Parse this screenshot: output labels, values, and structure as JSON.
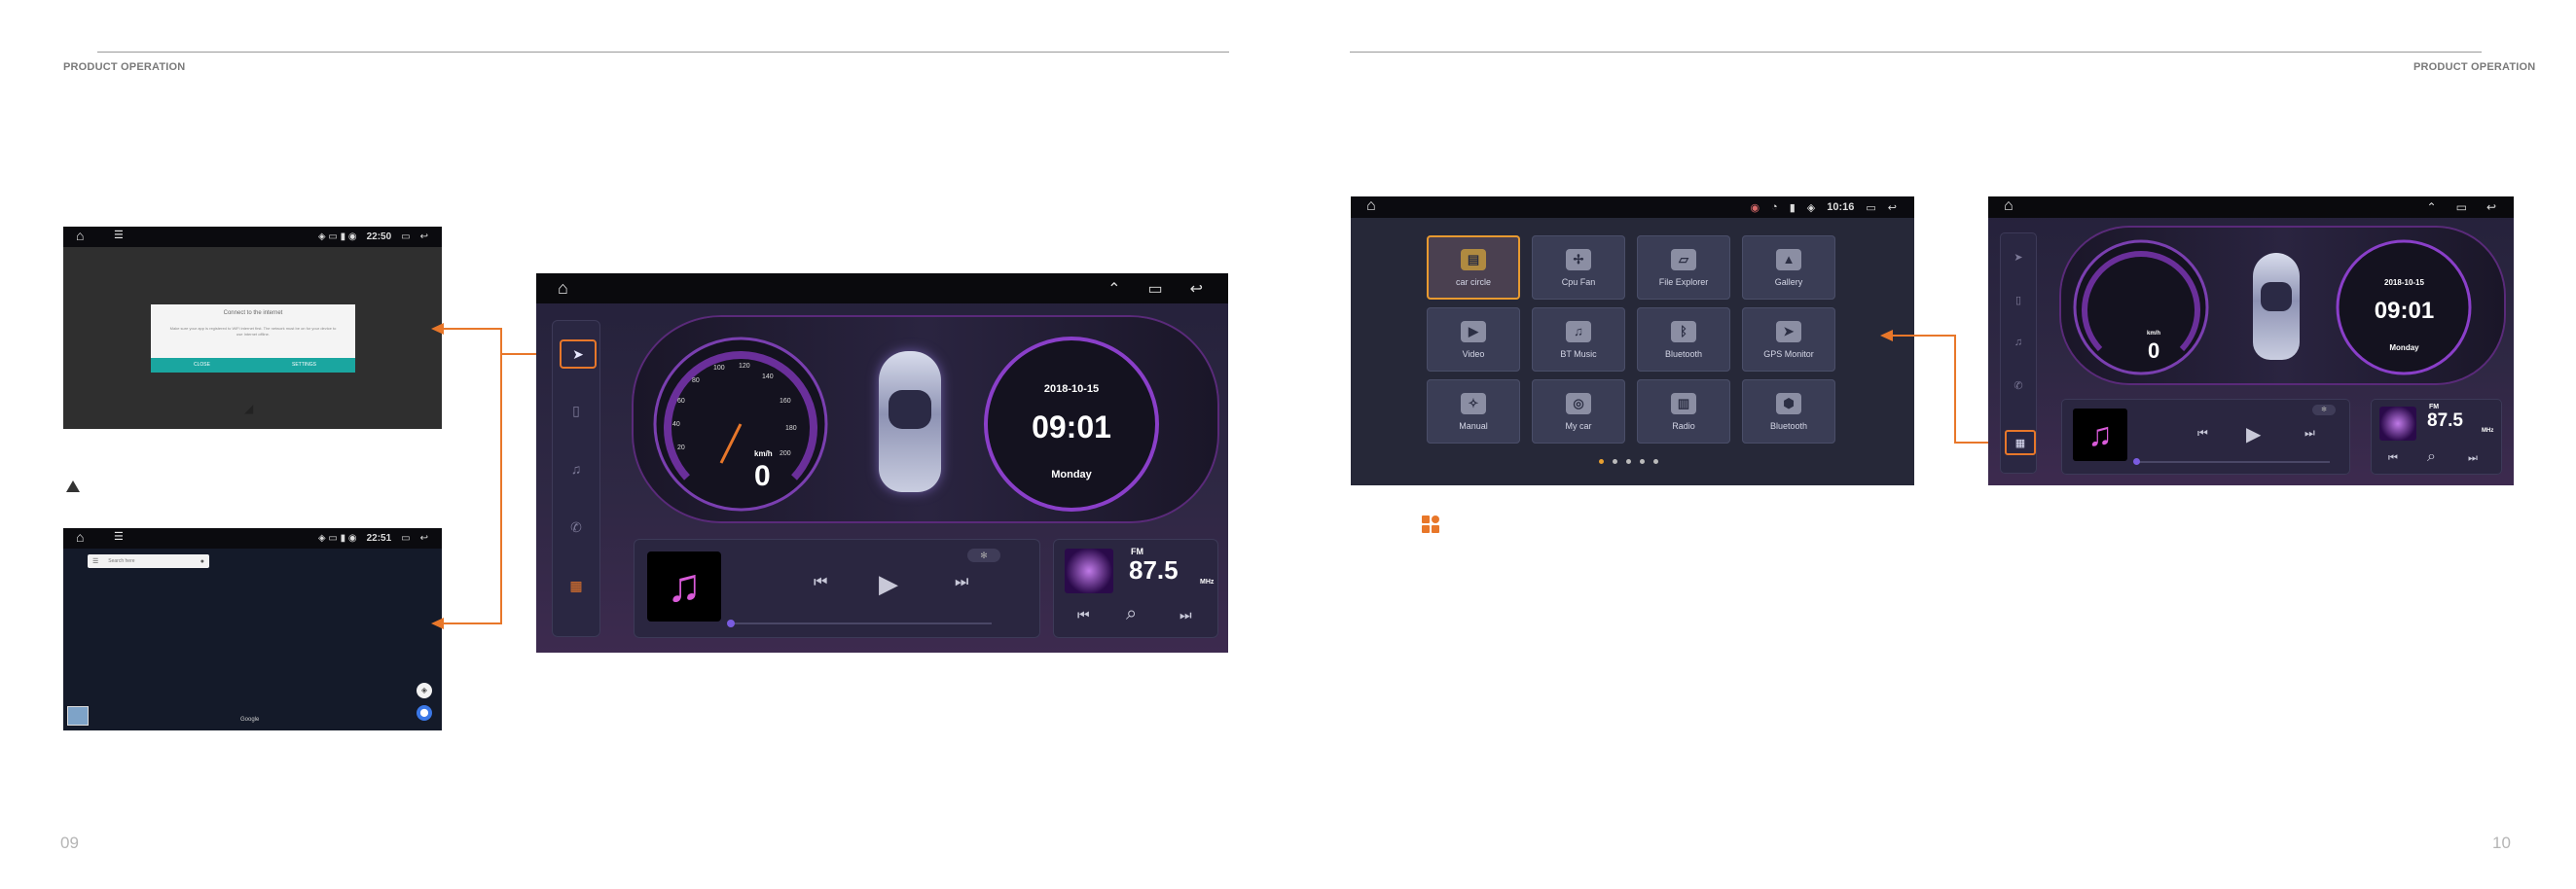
{
  "left_page": {
    "header": "PRODUCT OPERATION",
    "page_number": "09",
    "dialog_shot": {
      "time": "22:50",
      "dialog_title": "Connect to the internet",
      "dialog_body": "Make sure your app is registered to WiFi internet first. The network must be on for your device to use Internet offline.",
      "close_label": "CLOSE",
      "settings_label": "SETTINGS"
    },
    "warning_icon": "warning-triangle-icon",
    "map_shot": {
      "time": "22:51",
      "search_placeholder": "Search here",
      "google_label": "Google"
    },
    "dashboard": {
      "speed_unit": "km/h",
      "speed": "0",
      "gauge_ticks": [
        "20",
        "40",
        "60",
        "80",
        "100",
        "120",
        "140",
        "160",
        "180",
        "200"
      ],
      "date": "2018-10-15",
      "time": "09:01",
      "day": "Monday",
      "fm_label": "FM",
      "fm_freq": "87.5",
      "fm_unit": "MHz"
    }
  },
  "right_page": {
    "header": "PRODUCT OPERATION",
    "page_number": "10",
    "apps_shot": {
      "time": "10:16",
      "apps": [
        {
          "label": "car circle",
          "icon": "car-circle-icon",
          "selected": true
        },
        {
          "label": "Cpu Fan",
          "icon": "fan-icon"
        },
        {
          "label": "File Explorer",
          "icon": "folder-icon"
        },
        {
          "label": "Gallery",
          "icon": "gallery-icon"
        },
        {
          "label": "Video",
          "icon": "video-icon"
        },
        {
          "label": "BT Music",
          "icon": "music-icon"
        },
        {
          "label": "Bluetooth",
          "icon": "bluetooth-icon"
        },
        {
          "label": "GPS Monitor",
          "icon": "navigation-icon"
        },
        {
          "label": "Manual",
          "icon": "compass-icon"
        },
        {
          "label": "My car",
          "icon": "steering-icon"
        },
        {
          "label": "Radio",
          "icon": "radio-icon"
        },
        {
          "label": "Bluetooth",
          "icon": "bluetooth-settings-icon"
        }
      ]
    },
    "dashboard": {
      "speed_unit": "km/h",
      "speed": "0",
      "date": "2018-10-15",
      "time": "09:01",
      "day": "Monday",
      "fm_label": "FM",
      "fm_freq": "87.5",
      "fm_unit": "MHz"
    },
    "apps_icon": "apps-grid-icon"
  },
  "colors": {
    "accent": "#e8772a",
    "teal": "#1aa6a0",
    "dash_bg": "#2a2540",
    "purple": "#8a3fc9"
  }
}
